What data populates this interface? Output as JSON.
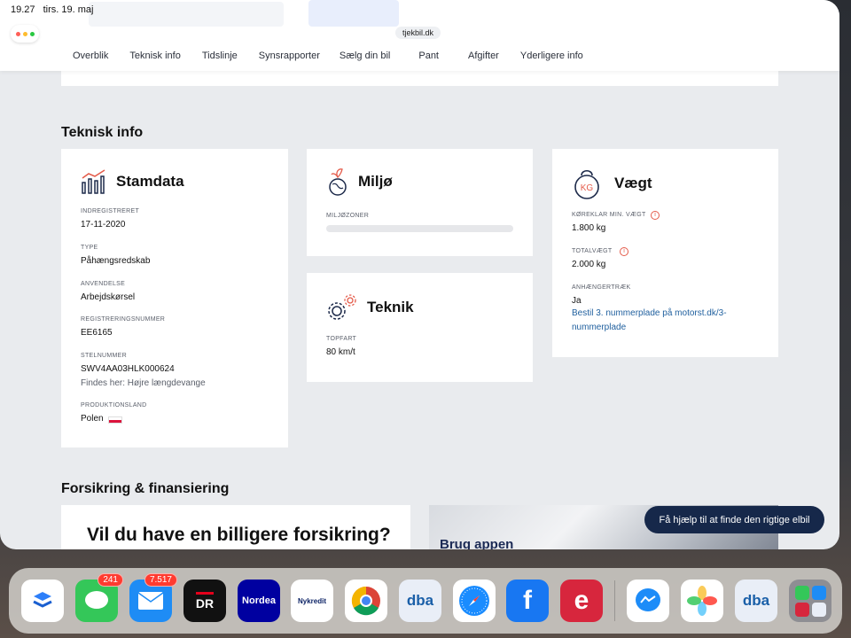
{
  "status": {
    "time": "19.27",
    "date": "tirs. 19. maj"
  },
  "browser": {
    "url": "tjekbil.dk"
  },
  "nav": {
    "tabs": [
      "Overblik",
      "Teknisk info",
      "Tidslinje",
      "Synsrapporter",
      "Sælg din bil",
      "Pant",
      "Afgifter",
      "Yderligere info"
    ]
  },
  "teknisk": {
    "heading": "Teknisk info",
    "stamdata": {
      "title": "Stamdata",
      "fields": [
        {
          "label": "INDREGISTRERET",
          "value": "17-11-2020"
        },
        {
          "label": "TYPE",
          "value": "Påhængsredskab"
        },
        {
          "label": "ANVENDELSE",
          "value": "Arbejdskørsel"
        },
        {
          "label": "REGISTRERINGSNUMMER",
          "value": "EE6165"
        },
        {
          "label": "STELNUMMER",
          "value": "SWV4AA03HLK000624",
          "note": "Findes her: Højre længdevange"
        },
        {
          "label": "PRODUKTIONSLAND",
          "value": "Polen"
        }
      ]
    },
    "miljo": {
      "title": "Miljø",
      "label": "MILJØZONER"
    },
    "teknik": {
      "title": "Teknik",
      "label": "TOPFART",
      "value": "80 km/t"
    },
    "vaegt": {
      "title": "Vægt",
      "icon_text": "KG",
      "fields": [
        {
          "label": "KØREKLAR MIN. VÆGT",
          "value": "1.800 kg"
        },
        {
          "label": "TOTALVÆGT",
          "value": "2.000 kg"
        },
        {
          "label": "ANHÆNGERTRÆK",
          "value": "Ja",
          "link": "Bestil 3. nummerplade på motorst.dk/3-nummerplade"
        }
      ]
    }
  },
  "forsikring": {
    "heading": "Forsikring & finansiering",
    "promo_title": "Vil du have en billigere forsikring?",
    "app_promo": "Brug appen"
  },
  "help_button": "Få hjælp til at finde den rigtige elbil",
  "dock": {
    "apps": [
      {
        "name": "tasks",
        "color": "#ffffff",
        "text": ""
      },
      {
        "name": "messages",
        "color": "#34c759",
        "badge": "241",
        "text": ""
      },
      {
        "name": "mail",
        "color": "#1e8cf5",
        "badge": "7.517",
        "text": ""
      },
      {
        "name": "dr",
        "color": "#111111",
        "text": "DR"
      },
      {
        "name": "nordea",
        "color": "#0000a0",
        "text": "Nordea"
      },
      {
        "name": "nykredit",
        "color": "#ffffff",
        "text": "Nykredit"
      },
      {
        "name": "chrome",
        "color": "#ffffff",
        "text": ""
      },
      {
        "name": "dba",
        "color": "#e9eef7",
        "text": "dba"
      },
      {
        "name": "safari",
        "color": "#ffffff",
        "text": ""
      },
      {
        "name": "facebook",
        "color": "#1877f2",
        "text": "f"
      },
      {
        "name": "e-app",
        "color": "#d7263d",
        "text": "e"
      },
      {
        "name": "messenger",
        "color": "#ffffff",
        "text": ""
      },
      {
        "name": "photos",
        "color": "#ffffff",
        "text": ""
      },
      {
        "name": "dba-2",
        "color": "#e9eef7",
        "text": "dba"
      },
      {
        "name": "app-library",
        "color": "#8e8e93",
        "text": ""
      }
    ]
  }
}
